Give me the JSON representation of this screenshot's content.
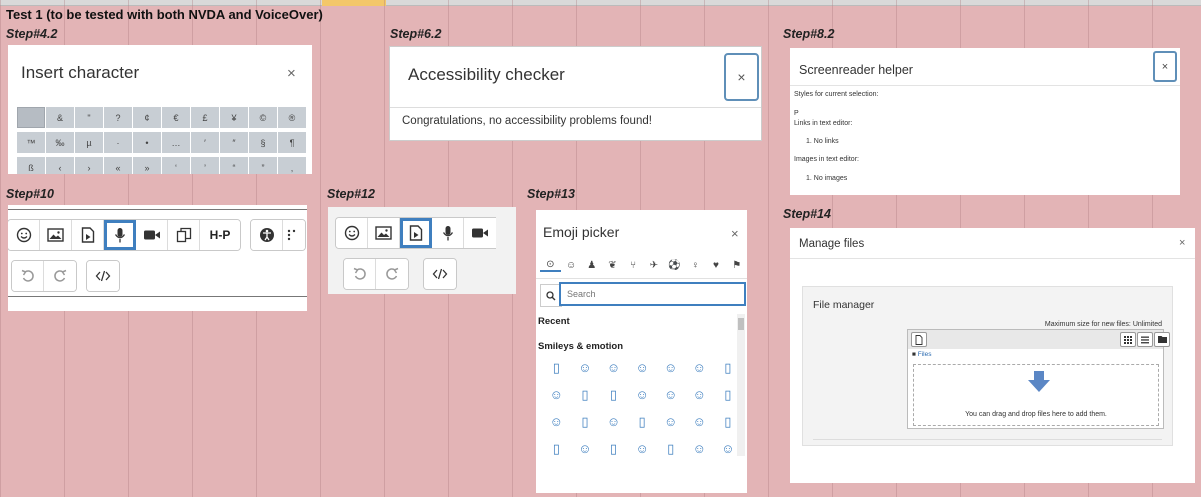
{
  "sheet": {
    "title": "Test 1 (to be tested with both NVDA and VoiceOver)"
  },
  "steps": {
    "s42": "Step#4.2",
    "s62": "Step#6.2",
    "s82": "Step#8.2",
    "s10": "Step#10",
    "s12": "Step#12",
    "s13": "Step#13",
    "s14": "Step#14"
  },
  "insert_character": {
    "title": "Insert character",
    "close": "×",
    "chars": [
      "",
      "&",
      "\"",
      "?",
      "¢",
      "€",
      "£",
      "¥",
      "©",
      "®",
      "™",
      "‰",
      "µ",
      "·",
      "•",
      "…",
      "′",
      "″",
      "§",
      "¶",
      "ß",
      "‹",
      "›",
      "«",
      "»",
      "‘",
      "’",
      "“",
      "”",
      "‚"
    ]
  },
  "accessibility_checker": {
    "title": "Accessibility checker",
    "close": "×",
    "message": "Congratulations, no accessibility problems found!"
  },
  "screenreader_helper": {
    "title": "Screenreader helper",
    "close": "×",
    "styles_label": "Styles for current selection:",
    "styles_value": "P",
    "links_label": "Links in text editor:",
    "links_value": "1. No links",
    "images_label": "Images in text editor:",
    "images_value": "1. No images"
  },
  "toolbar": {
    "h5p": "H-P"
  },
  "emoji_picker": {
    "title": "Emoji picker",
    "close": "×",
    "categories": [
      "⊙",
      "☺",
      "♟",
      "❦",
      "⑂",
      "✈",
      "⚽",
      "♀",
      "♥",
      "⚑"
    ],
    "search_placeholder": "Search",
    "recent": "Recent",
    "smileys": "Smileys & emotion",
    "emojis": [
      "▯",
      "☺",
      "☺",
      "☺",
      "☺",
      "☺",
      "▯",
      "☺",
      "▯",
      "▯",
      "☺",
      "☺",
      "☺",
      "▯",
      "☺",
      "▯",
      "☺",
      "▯",
      "☺",
      "☺",
      "▯",
      "▯",
      "☺",
      "▯",
      "☺",
      "▯",
      "☺",
      "☺"
    ]
  },
  "manage_files": {
    "title": "Manage files",
    "close": "×",
    "file_manager": "File manager",
    "max_size": "Maximum size for new files: Unlimited",
    "files": "Files",
    "drop_text": "You can drag and drop files here to add them."
  }
}
